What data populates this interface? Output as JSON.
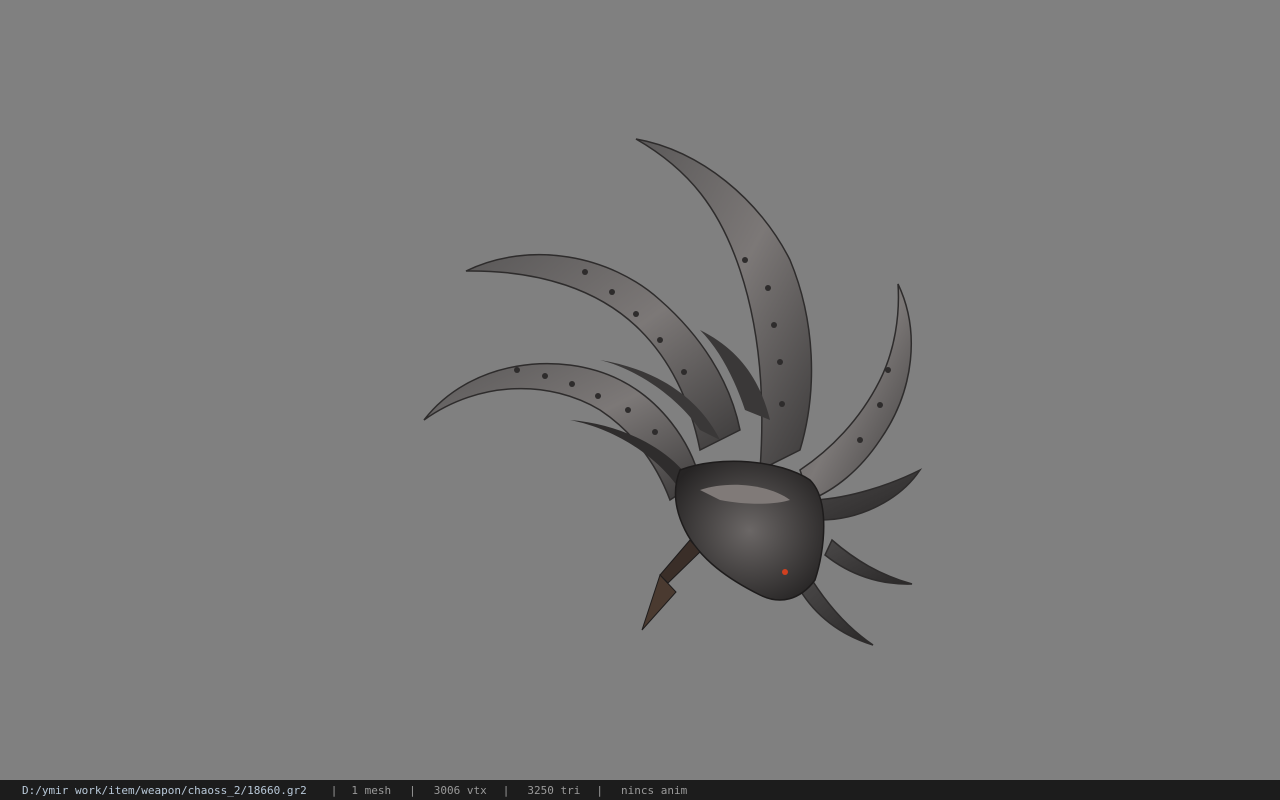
{
  "viewport": {
    "background_color": "#808080",
    "model": {
      "description_icon": "claw-weapon-model",
      "primary_color": "#4a4a4a",
      "highlight_color": "#8a8580",
      "eye_color": "#d04020"
    }
  },
  "status_bar": {
    "path": "D:/ymir work/item/weapon/chaoss_2/18660.gr2",
    "separator": "|",
    "mesh": "1 mesh",
    "vtx": "3006 vtx",
    "tri": "3250 tri",
    "anim": "nincs anim",
    "background_color": "#1c1c1c",
    "text_color": "#9a9a9a"
  }
}
